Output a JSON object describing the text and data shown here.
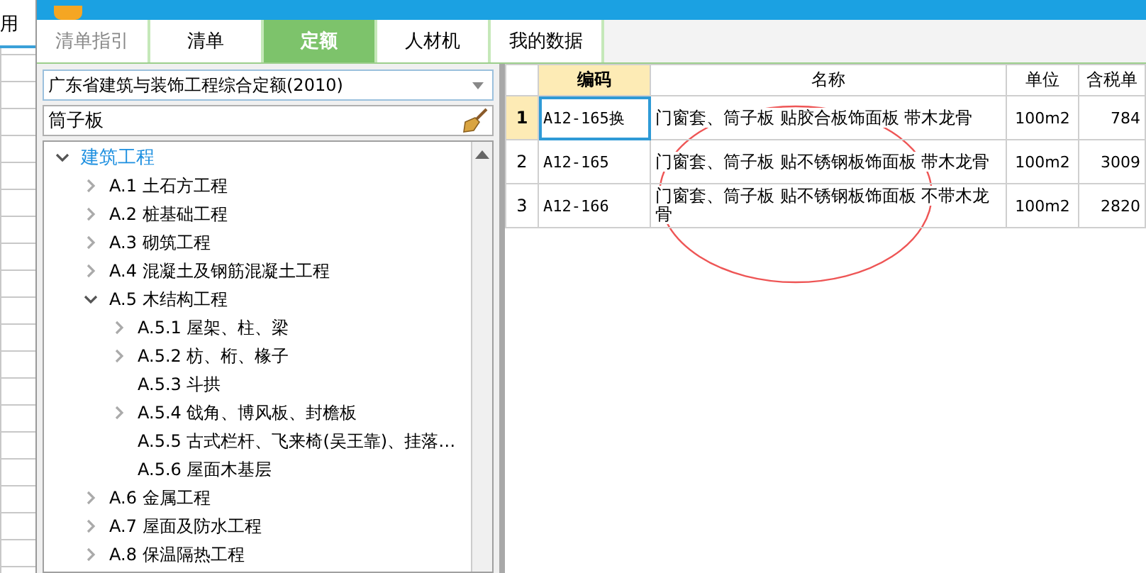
{
  "background_app": {
    "label": "用"
  },
  "tabs": [
    {
      "label": "清单指引",
      "selected": false,
      "disabled": true
    },
    {
      "label": "清单",
      "selected": false,
      "disabled": false
    },
    {
      "label": "定额",
      "selected": true,
      "disabled": false
    },
    {
      "label": "人材机",
      "selected": false,
      "disabled": false
    },
    {
      "label": "我的数据",
      "selected": false,
      "disabled": false
    }
  ],
  "library_dropdown": {
    "value": "广东省建筑与装饰工程综合定额(2010)"
  },
  "search": {
    "value": "筒子板"
  },
  "tree": [
    {
      "label": "建筑工程",
      "expanded": true,
      "selected": true,
      "children": [
        {
          "label": "A.1 土石方工程",
          "expanded": false,
          "selected": false
        },
        {
          "label": "A.2 桩基础工程",
          "expanded": false,
          "selected": false
        },
        {
          "label": "A.3 砌筑工程",
          "expanded": false,
          "selected": false
        },
        {
          "label": "A.4 混凝土及钢筋混凝土工程",
          "expanded": false,
          "selected": false
        },
        {
          "label": "A.5 木结构工程",
          "expanded": true,
          "selected": false,
          "children": [
            {
              "label": "A.5.1 屋架、柱、梁",
              "expanded": false,
              "selected": false
            },
            {
              "label": "A.5.2 枋、桁、椽子",
              "expanded": false,
              "selected": false
            },
            {
              "label": "A.5.3 斗拱",
              "selected": false
            },
            {
              "label": "A.5.4 戗角、博风板、封檐板",
              "expanded": false,
              "selected": false
            },
            {
              "label": "A.5.5 古式栏杆、飞来椅(吴王靠)、挂落…",
              "selected": false
            },
            {
              "label": "A.5.6 屋面木基层",
              "selected": false
            }
          ]
        },
        {
          "label": "A.6 金属工程",
          "expanded": false,
          "selected": false
        },
        {
          "label": "A.7 屋面及防水工程",
          "expanded": false,
          "selected": false
        },
        {
          "label": "A.8 保温隔热工程",
          "expanded": false,
          "selected": false
        }
      ]
    }
  ],
  "table": {
    "columns": [
      "编码",
      "名称",
      "单位",
      "含税单"
    ],
    "rows": [
      {
        "index": "1",
        "code": "A12-165换",
        "name": "门窗套、筒子板 贴胶合板饰面板 带木龙骨",
        "unit": "100m2",
        "price": "784",
        "selected": true
      },
      {
        "index": "2",
        "code": "A12-165",
        "name": "门窗套、筒子板 贴不锈钢板饰面板 带木龙骨",
        "unit": "100m2",
        "price": "3009",
        "selected": false
      },
      {
        "index": "3",
        "code": "A12-166",
        "name": "门窗套、筒子板 贴不锈钢板饰面板 不带木龙骨",
        "unit": "100m2",
        "price": "2820",
        "selected": false
      }
    ]
  }
}
